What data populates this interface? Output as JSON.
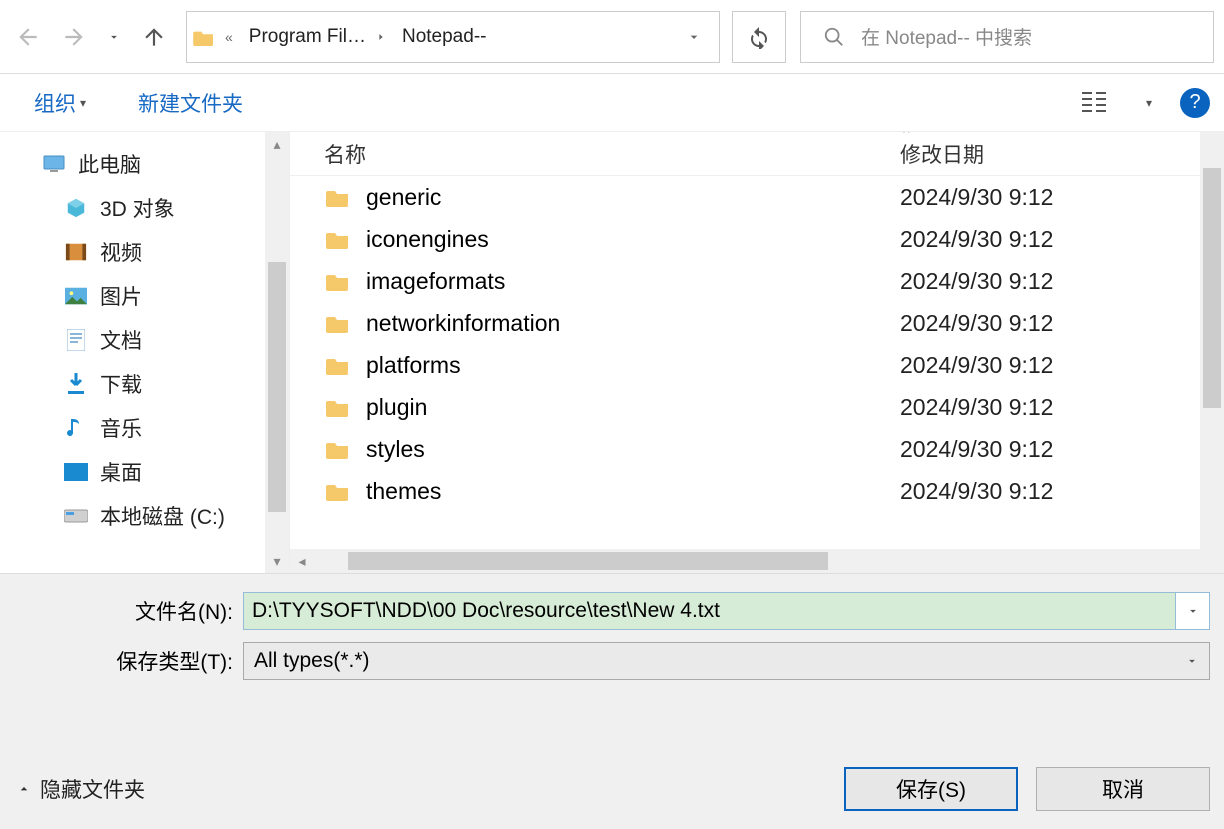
{
  "breadcrumb": {
    "segments": [
      "Program Fil…",
      "Notepad--"
    ]
  },
  "search": {
    "placeholder": "在 Notepad-- 中搜索"
  },
  "toolbar": {
    "organize": "组织",
    "new_folder": "新建文件夹"
  },
  "columns": {
    "name": "名称",
    "date": "修改日期"
  },
  "sidebar": {
    "root": "此电脑",
    "items": [
      "3D 对象",
      "视频",
      "图片",
      "文档",
      "下载",
      "音乐",
      "桌面",
      "本地磁盘 (C:)"
    ]
  },
  "files": [
    {
      "name": "generic",
      "date": "2024/9/30 9:12"
    },
    {
      "name": "iconengines",
      "date": "2024/9/30 9:12"
    },
    {
      "name": "imageformats",
      "date": "2024/9/30 9:12"
    },
    {
      "name": "networkinformation",
      "date": "2024/9/30 9:12"
    },
    {
      "name": "platforms",
      "date": "2024/9/30 9:12"
    },
    {
      "name": "plugin",
      "date": "2024/9/30 9:12"
    },
    {
      "name": "styles",
      "date": "2024/9/30 9:12"
    },
    {
      "name": "themes",
      "date": "2024/9/30 9:12"
    }
  ],
  "form": {
    "filename_label": "文件名(N):",
    "filename_value": "D:\\TYYSOFT\\NDD\\00 Doc\\resource\\test\\New 4.txt",
    "filetype_label": "保存类型(T):",
    "filetype_value": "All types(*.*)"
  },
  "footer": {
    "hide_folders": "隐藏文件夹",
    "save": "保存(S)",
    "cancel": "取消"
  }
}
